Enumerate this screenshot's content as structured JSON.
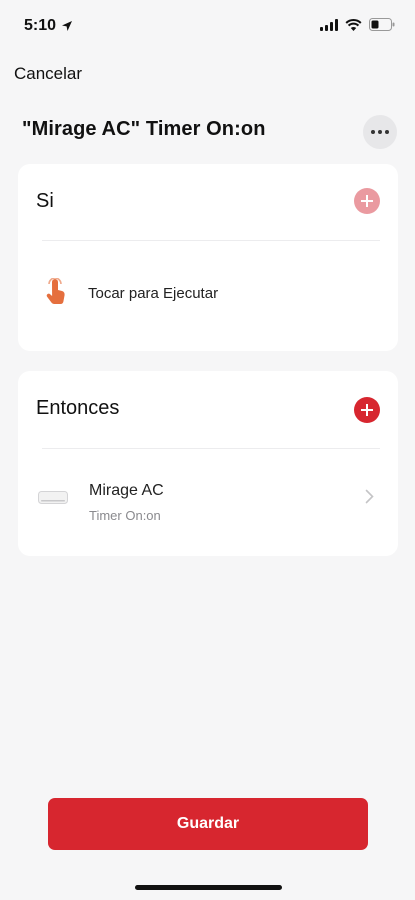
{
  "status_bar": {
    "time": "5:10"
  },
  "nav": {
    "cancel_label": "Cancelar"
  },
  "header": {
    "title": "\"Mirage AC\" Timer On:on"
  },
  "if_card": {
    "title": "Si",
    "trigger_label": "Tocar para Ejecutar"
  },
  "then_card": {
    "title": "Entonces",
    "device_name": "Mirage AC",
    "device_action": "Timer On:on"
  },
  "footer": {
    "save_label": "Guardar"
  },
  "colors": {
    "accent": "#d7262f",
    "accent_disabled": "#ea9aa0",
    "hand_icon": "#e56f3e"
  }
}
